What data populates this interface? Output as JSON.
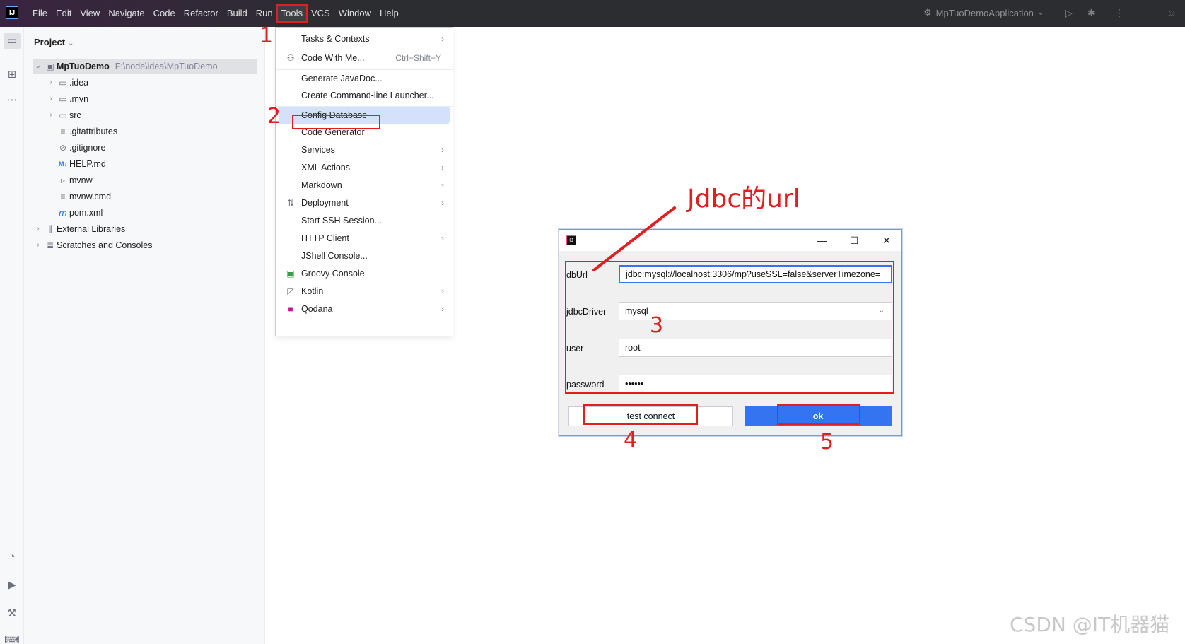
{
  "app": {
    "logo": "IJ"
  },
  "menubar": [
    "File",
    "Edit",
    "View",
    "Navigate",
    "Code",
    "Refactor",
    "Build",
    "Run",
    "Tools",
    "VCS",
    "Window",
    "Help"
  ],
  "toolbar": {
    "run_config": "MpTuoDemoApplication"
  },
  "project": {
    "header": "Project",
    "root": {
      "name": "MpTuoDemo",
      "path": "F:\\node\\idea\\MpTuoDemo"
    },
    "items": [
      {
        "label": ".idea",
        "icon": "folder-icon"
      },
      {
        "label": ".mvn",
        "icon": "folder-icon"
      },
      {
        "label": "src",
        "icon": "folder-icon"
      },
      {
        "label": ".gitattributes",
        "icon": "text-file-icon"
      },
      {
        "label": ".gitignore",
        "icon": "ignore-file-icon"
      },
      {
        "label": "HELP.md",
        "icon": "markdown-icon"
      },
      {
        "label": "mvnw",
        "icon": "shell-file-icon"
      },
      {
        "label": "mvnw.cmd",
        "icon": "text-file-icon"
      },
      {
        "label": "pom.xml",
        "icon": "maven-icon"
      }
    ],
    "external_libraries": "External Libraries",
    "scratches": "Scratches and Consoles"
  },
  "tools_menu": {
    "items": [
      {
        "label": "Tasks & Contexts",
        "submenu": true
      },
      {
        "label": "Code With Me...",
        "shortcut": "Ctrl+Shift+Y"
      },
      {
        "label": "Generate JavaDoc..."
      },
      {
        "label": "Create Command-line Launcher..."
      },
      {
        "label": "Config Database"
      },
      {
        "label": "Code Generator"
      },
      {
        "label": "Services",
        "submenu": true
      },
      {
        "label": "XML Actions",
        "submenu": true
      },
      {
        "label": "Markdown",
        "submenu": true
      },
      {
        "label": "Deployment",
        "submenu": true
      },
      {
        "label": "Start SSH Session..."
      },
      {
        "label": "HTTP Client",
        "submenu": true
      },
      {
        "label": "JShell Console..."
      },
      {
        "label": "Groovy Console"
      },
      {
        "label": "Kotlin",
        "submenu": true
      },
      {
        "label": "Qodana",
        "submenu": true
      }
    ]
  },
  "dialog": {
    "fields": {
      "dbUrl": {
        "label": "dbUrl",
        "value": "jdbc:mysql://localhost:3306/mp?useSSL=false&serverTimezone="
      },
      "jdbcDriver": {
        "label": "jdbcDriver",
        "value": "mysql"
      },
      "user": {
        "label": "user",
        "value": "root"
      },
      "password": {
        "label": "password",
        "value": "••••••"
      }
    },
    "test_button": "test connect",
    "ok_button": "ok"
  },
  "annotations": {
    "n1": "1",
    "n2": "2",
    "n3": "3",
    "n4": "4",
    "n5": "5",
    "jdbc_url": "Jdbc的url",
    "color": "#e02020"
  },
  "watermark": "CSDN @IT机器猫"
}
